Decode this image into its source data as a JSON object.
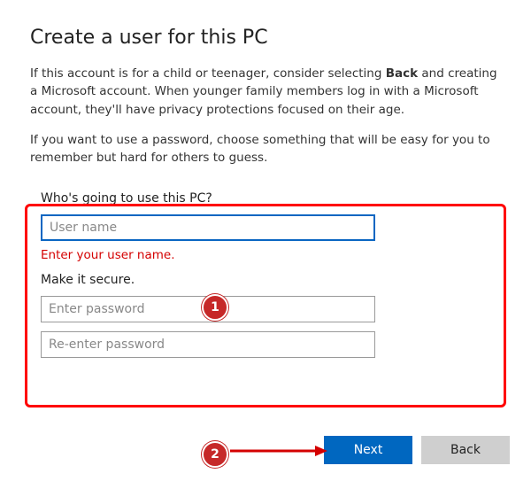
{
  "heading": "Create a user for this PC",
  "intro1_pre": "If this account is for a child or teenager, consider selecting ",
  "intro1_bold": "Back",
  "intro1_post": " and creating a Microsoft account. When younger family members log in with a Microsoft account, they'll have privacy protections focused on their age.",
  "intro2": "If you want to use a password, choose something that will be easy for you to remember but hard for others to guess.",
  "form": {
    "who_label": "Who's going to use this PC?",
    "username_placeholder": "User name",
    "username_value": "",
    "username_error": "Enter your user name.",
    "secure_label": "Make it secure.",
    "password_placeholder": "Enter password",
    "password_value": "",
    "confirm_placeholder": "Re-enter password",
    "confirm_value": ""
  },
  "buttons": {
    "next": "Next",
    "back": "Back"
  },
  "annotations": {
    "badge1": "1",
    "badge2": "2"
  },
  "colors": {
    "primary": "#0067c0",
    "error": "#d40000",
    "annotation": "#c62828"
  }
}
